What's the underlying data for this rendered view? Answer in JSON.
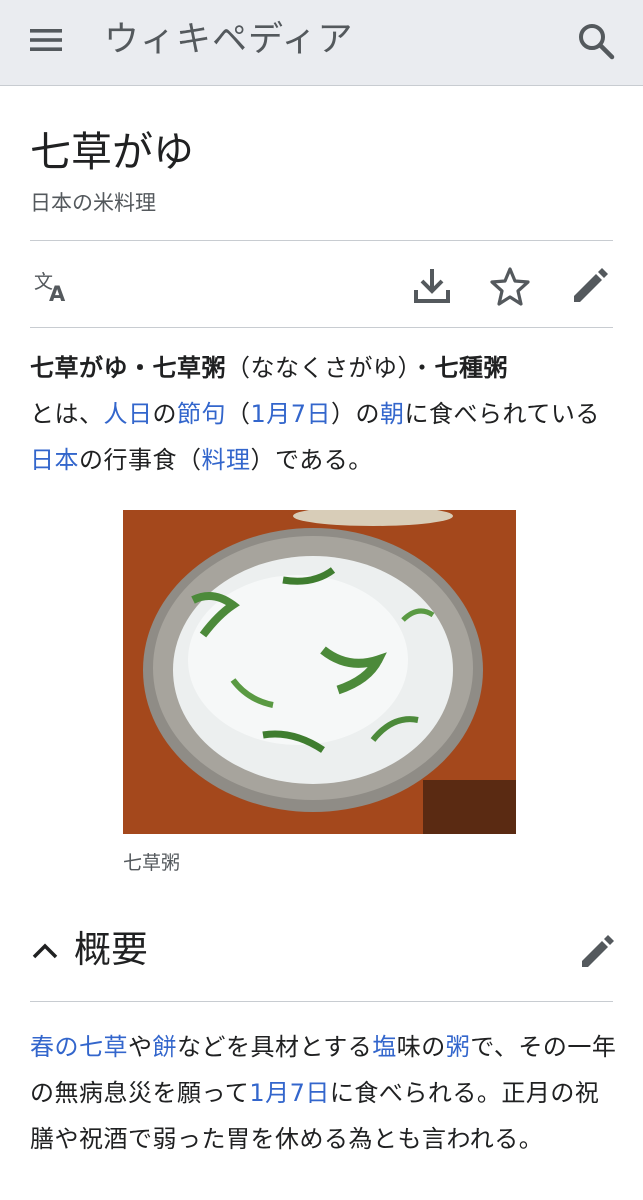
{
  "header": {
    "logo": "ウィキペディア"
  },
  "article": {
    "title": "七草がゆ",
    "description": "日本の米料理"
  },
  "intro": {
    "b1": "七草がゆ・七草粥",
    "t1": "（ななくさがゆ）・",
    "b2": "七種粥",
    "t2": "とは、",
    "l1": "人日",
    "t3": "の",
    "l2": "節句",
    "t4": "（",
    "l3": "1月7日",
    "t5": "）の",
    "l4": "朝",
    "t6": "に食べられている",
    "l5": "日本",
    "t7": "の行事食（",
    "l6": "料理",
    "t8": "）である。"
  },
  "figure": {
    "caption": "七草粥"
  },
  "section": {
    "title": "概要"
  },
  "overview": {
    "l1": "春の七草",
    "t1": "や",
    "l2": "餅",
    "t2": "などを具材とする",
    "l3": "塩",
    "t3": "味の",
    "l4": "粥",
    "t4": "で、その一年の無病息災を願って",
    "l5": "1月7日",
    "t5": "に食べられる。正月の祝膳や祝酒で弱った胃を休める為とも言われる。"
  },
  "colors": {
    "link": "#3366cc",
    "header_bg": "#eaecf0",
    "icon": "#54595d"
  }
}
